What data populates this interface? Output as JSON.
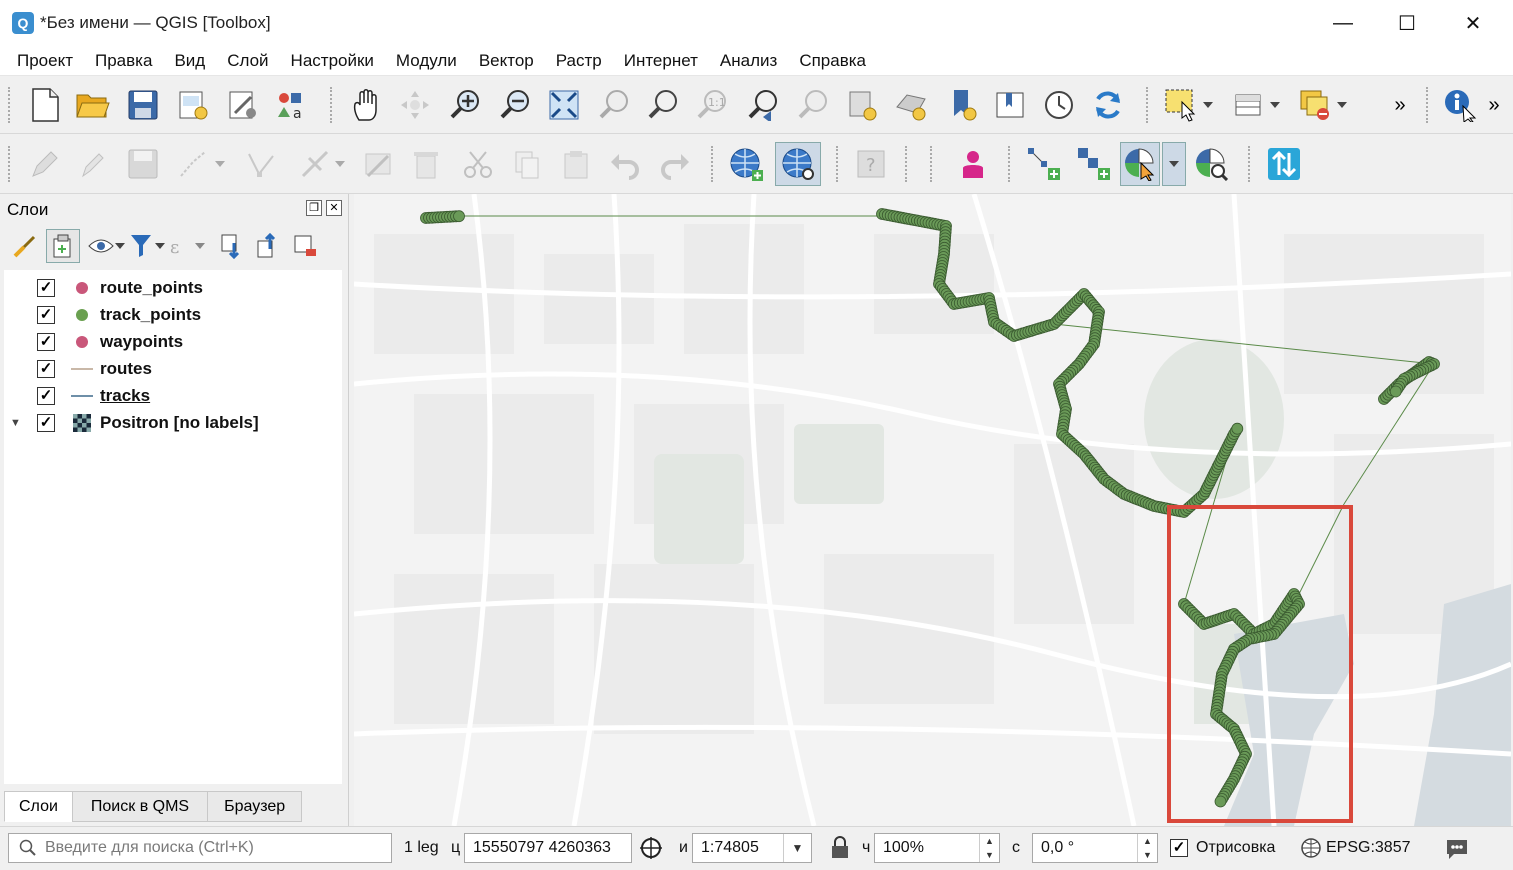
{
  "window": {
    "title": "*Без имени — QGIS [Toolbox]",
    "app_icon": "Q",
    "controls": {
      "minimize": "—",
      "maximize": "☐",
      "close": "✕"
    }
  },
  "menu": [
    "Проект",
    "Правка",
    "Вид",
    "Слой",
    "Настройки",
    "Модули",
    "Вектор",
    "Растр",
    "Интернет",
    "Анализ",
    "Справка"
  ],
  "toolbar": {
    "overflow": "»"
  },
  "layers_panel": {
    "title": "Слои",
    "layers": [
      {
        "name": "route_points",
        "checked": "✓",
        "symbol": "point",
        "color": "#c9577a"
      },
      {
        "name": "track_points",
        "checked": "✓",
        "symbol": "point",
        "color": "#6aa050"
      },
      {
        "name": "waypoints",
        "checked": "✓",
        "symbol": "point",
        "color": "#c9577a"
      },
      {
        "name": "routes",
        "checked": "✓",
        "symbol": "line",
        "color": "#c9b8a8"
      },
      {
        "name": "tracks",
        "checked": "✓",
        "symbol": "line",
        "color": "#6e8fa8"
      },
      {
        "name": "Positron [no labels]",
        "checked": "✓",
        "symbol": "raster",
        "expander": "▼"
      }
    ],
    "tabs": [
      "Слои",
      "Поиск в QMS",
      "Браузер"
    ]
  },
  "map": {
    "track_color": "#6a9a58",
    "track_stroke": "#3a5a30",
    "line_color": "#5a8a48",
    "highlight_color": "#d9483b"
  },
  "statusbar": {
    "search_placeholder": "Введите для поиска (Ctrl+K)",
    "legend_label": "1 leg",
    "coordinate_label": "ц",
    "coordinates": "15550797  4260363",
    "scale_label": "и",
    "scale": "1:74805",
    "magnifier_label": "ч",
    "magnifier": "100%",
    "rotation_label": "с",
    "rotation": "0,0 °",
    "render_checked": "✓",
    "render_label": "Отрисовка",
    "crs": "EPSG:3857"
  }
}
